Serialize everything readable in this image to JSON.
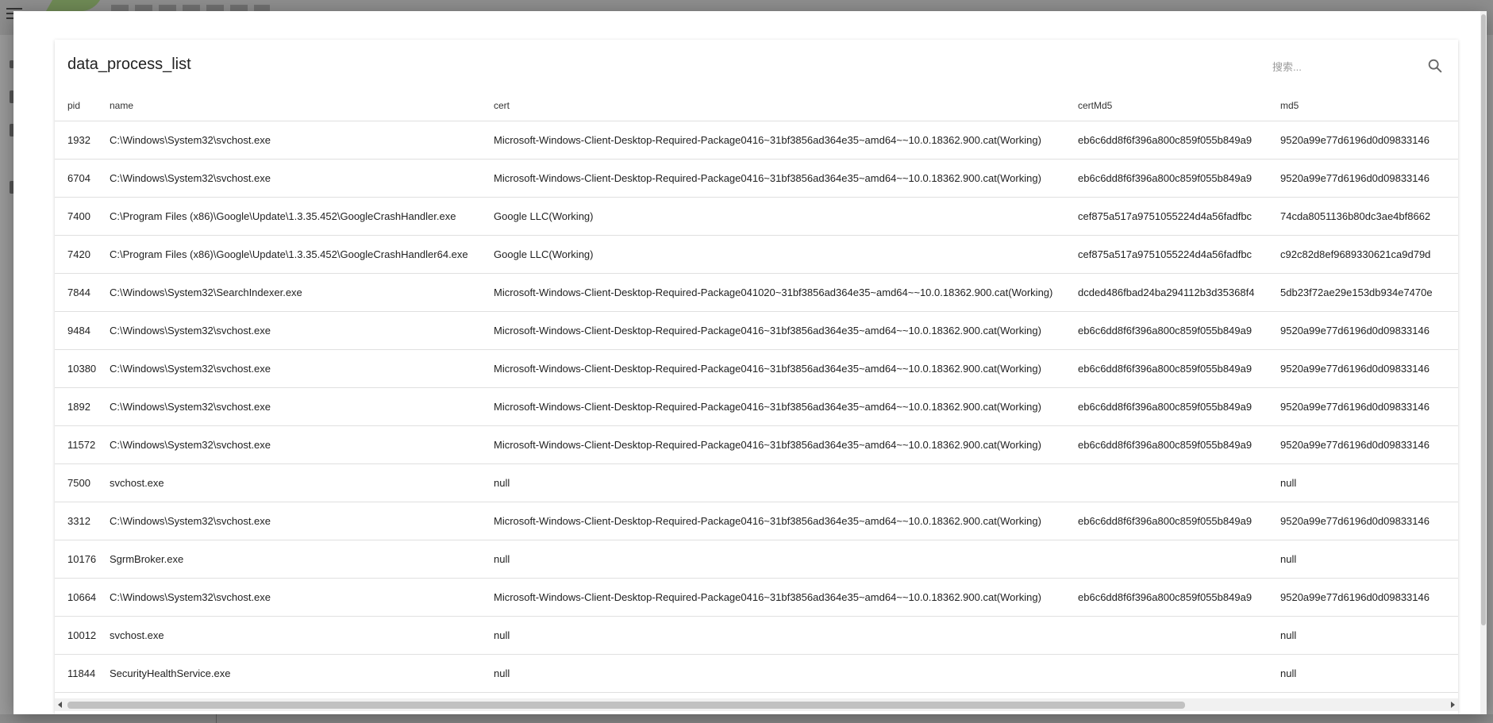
{
  "dialog": {
    "title": "data_process_list",
    "search": {
      "placeholder": "搜索..."
    }
  },
  "table": {
    "columns": [
      "pid",
      "name",
      "cert",
      "certMd5",
      "md5"
    ],
    "rows": [
      [
        "1932",
        "C:\\Windows\\System32\\svchost.exe",
        "Microsoft-Windows-Client-Desktop-Required-Package0416~31bf3856ad364e35~amd64~~10.0.18362.900.cat(Working)",
        "eb6c6dd8f6f396a800c859f055b849a9",
        "9520a99e77d6196d0d09833146"
      ],
      [
        "6704",
        "C:\\Windows\\System32\\svchost.exe",
        "Microsoft-Windows-Client-Desktop-Required-Package0416~31bf3856ad364e35~amd64~~10.0.18362.900.cat(Working)",
        "eb6c6dd8f6f396a800c859f055b849a9",
        "9520a99e77d6196d0d09833146"
      ],
      [
        "7400",
        "C:\\Program Files (x86)\\Google\\Update\\1.3.35.452\\GoogleCrashHandler.exe",
        "Google LLC(Working)",
        "cef875a517a9751055224d4a56fadfbc",
        "74cda8051136b80dc3ae4bf8662"
      ],
      [
        "7420",
        "C:\\Program Files (x86)\\Google\\Update\\1.3.35.452\\GoogleCrashHandler64.exe",
        "Google LLC(Working)",
        "cef875a517a9751055224d4a56fadfbc",
        "c92c82d8ef9689330621ca9d79d"
      ],
      [
        "7844",
        "C:\\Windows\\System32\\SearchIndexer.exe",
        "Microsoft-Windows-Client-Desktop-Required-Package041020~31bf3856ad364e35~amd64~~10.0.18362.900.cat(Working)",
        "dcded486fbad24ba294112b3d35368f4",
        "5db23f72ae29e153db934e7470e"
      ],
      [
        "9484",
        "C:\\Windows\\System32\\svchost.exe",
        "Microsoft-Windows-Client-Desktop-Required-Package0416~31bf3856ad364e35~amd64~~10.0.18362.900.cat(Working)",
        "eb6c6dd8f6f396a800c859f055b849a9",
        "9520a99e77d6196d0d09833146"
      ],
      [
        "10380",
        "C:\\Windows\\System32\\svchost.exe",
        "Microsoft-Windows-Client-Desktop-Required-Package0416~31bf3856ad364e35~amd64~~10.0.18362.900.cat(Working)",
        "eb6c6dd8f6f396a800c859f055b849a9",
        "9520a99e77d6196d0d09833146"
      ],
      [
        "1892",
        "C:\\Windows\\System32\\svchost.exe",
        "Microsoft-Windows-Client-Desktop-Required-Package0416~31bf3856ad364e35~amd64~~10.0.18362.900.cat(Working)",
        "eb6c6dd8f6f396a800c859f055b849a9",
        "9520a99e77d6196d0d09833146"
      ],
      [
        "11572",
        "C:\\Windows\\System32\\svchost.exe",
        "Microsoft-Windows-Client-Desktop-Required-Package0416~31bf3856ad364e35~amd64~~10.0.18362.900.cat(Working)",
        "eb6c6dd8f6f396a800c859f055b849a9",
        "9520a99e77d6196d0d09833146"
      ],
      [
        "7500",
        "svchost.exe",
        "null",
        "",
        "null"
      ],
      [
        "3312",
        "C:\\Windows\\System32\\svchost.exe",
        "Microsoft-Windows-Client-Desktop-Required-Package0416~31bf3856ad364e35~amd64~~10.0.18362.900.cat(Working)",
        "eb6c6dd8f6f396a800c859f055b849a9",
        "9520a99e77d6196d0d09833146"
      ],
      [
        "10176",
        "SgrmBroker.exe",
        "null",
        "",
        "null"
      ],
      [
        "10664",
        "C:\\Windows\\System32\\svchost.exe",
        "Microsoft-Windows-Client-Desktop-Required-Package0416~31bf3856ad364e35~amd64~~10.0.18362.900.cat(Working)",
        "eb6c6dd8f6f396a800c859f055b849a9",
        "9520a99e77d6196d0d09833146"
      ],
      [
        "10012",
        "svchost.exe",
        "null",
        "",
        "null"
      ],
      [
        "11844",
        "SecurityHealthService.exe",
        "null",
        "",
        "null"
      ]
    ]
  },
  "icons": {
    "search": "search-icon",
    "menu": "menu-icon",
    "scroll_left": "chevron-left-icon",
    "scroll_right": "chevron-right-icon"
  },
  "colors": {
    "backdrop": "#9b9b9b",
    "surface": "#ffffff",
    "divider": "#e0e0e0",
    "scroll_thumb": "#c1c1c1"
  }
}
